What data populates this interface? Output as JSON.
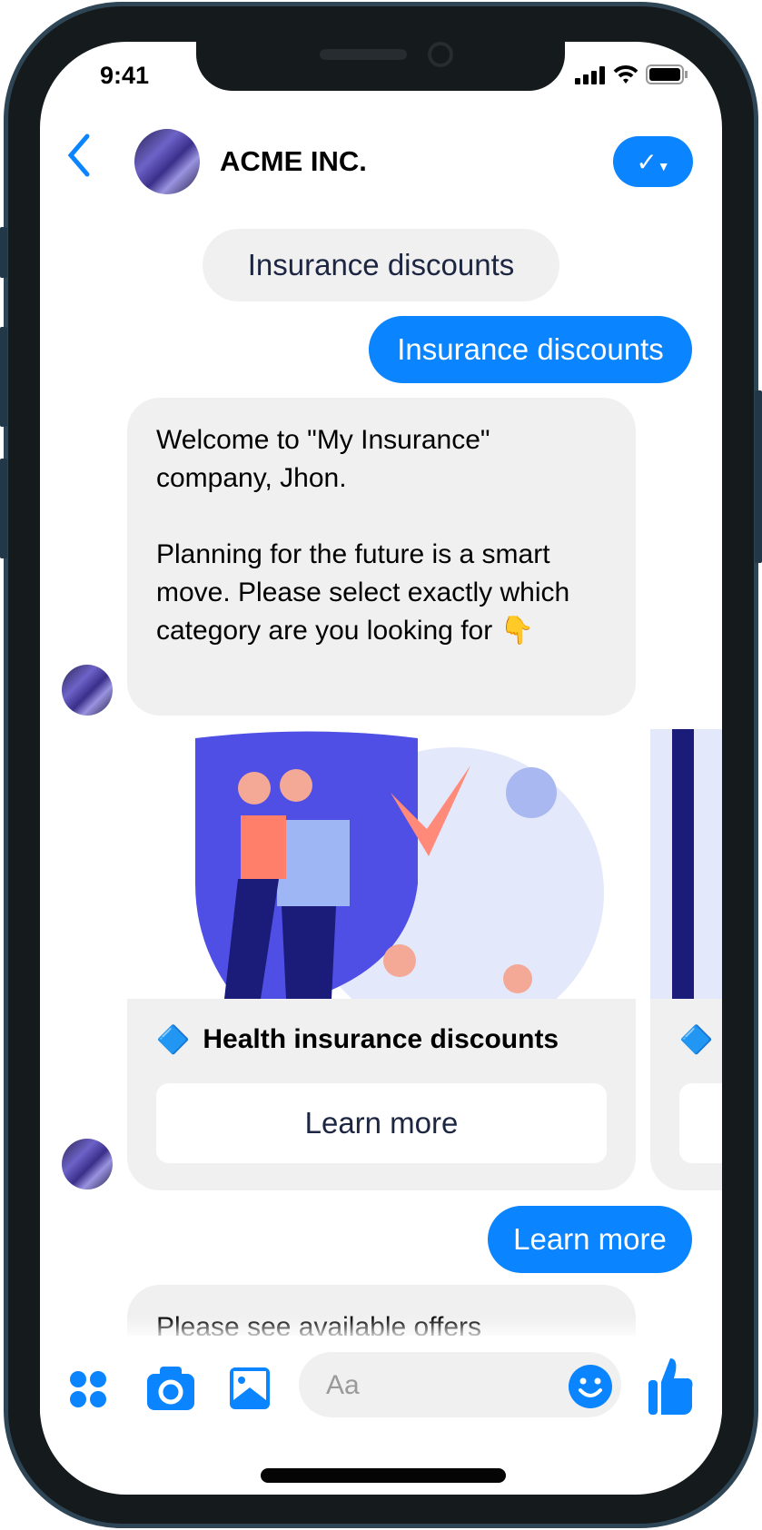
{
  "status_bar": {
    "time": "9:41",
    "icons": [
      "signal-icon",
      "wifi-icon",
      "battery-icon"
    ]
  },
  "header": {
    "title": "ACME INC.",
    "back_icon": "chevron-left-icon",
    "action_icon": "check-dropdown-icon",
    "accent": "#0a84ff"
  },
  "messages": [
    {
      "from": "system",
      "text": "Insurance discounts"
    },
    {
      "from": "user",
      "text": "Insurance discounts"
    },
    {
      "from": "bot",
      "text": "Welcome to \"My Insurance\" company, Jhon.\n\nPlanning for the future is a smart move. Please select exactly which category are you looking for 👇"
    },
    {
      "from": "user",
      "text": "Learn more"
    },
    {
      "from": "bot",
      "text": "Please see available offers"
    }
  ],
  "cards": [
    {
      "icon": "🔷",
      "title": "Health insurance discounts",
      "button": "Learn more"
    },
    {
      "icon": "🔷",
      "title": "",
      "button": ""
    }
  ],
  "composer": {
    "placeholder": "Aa",
    "icons": [
      "apps-icon",
      "camera-icon",
      "image-icon",
      "emoji-icon",
      "thumbs-up-icon"
    ]
  }
}
